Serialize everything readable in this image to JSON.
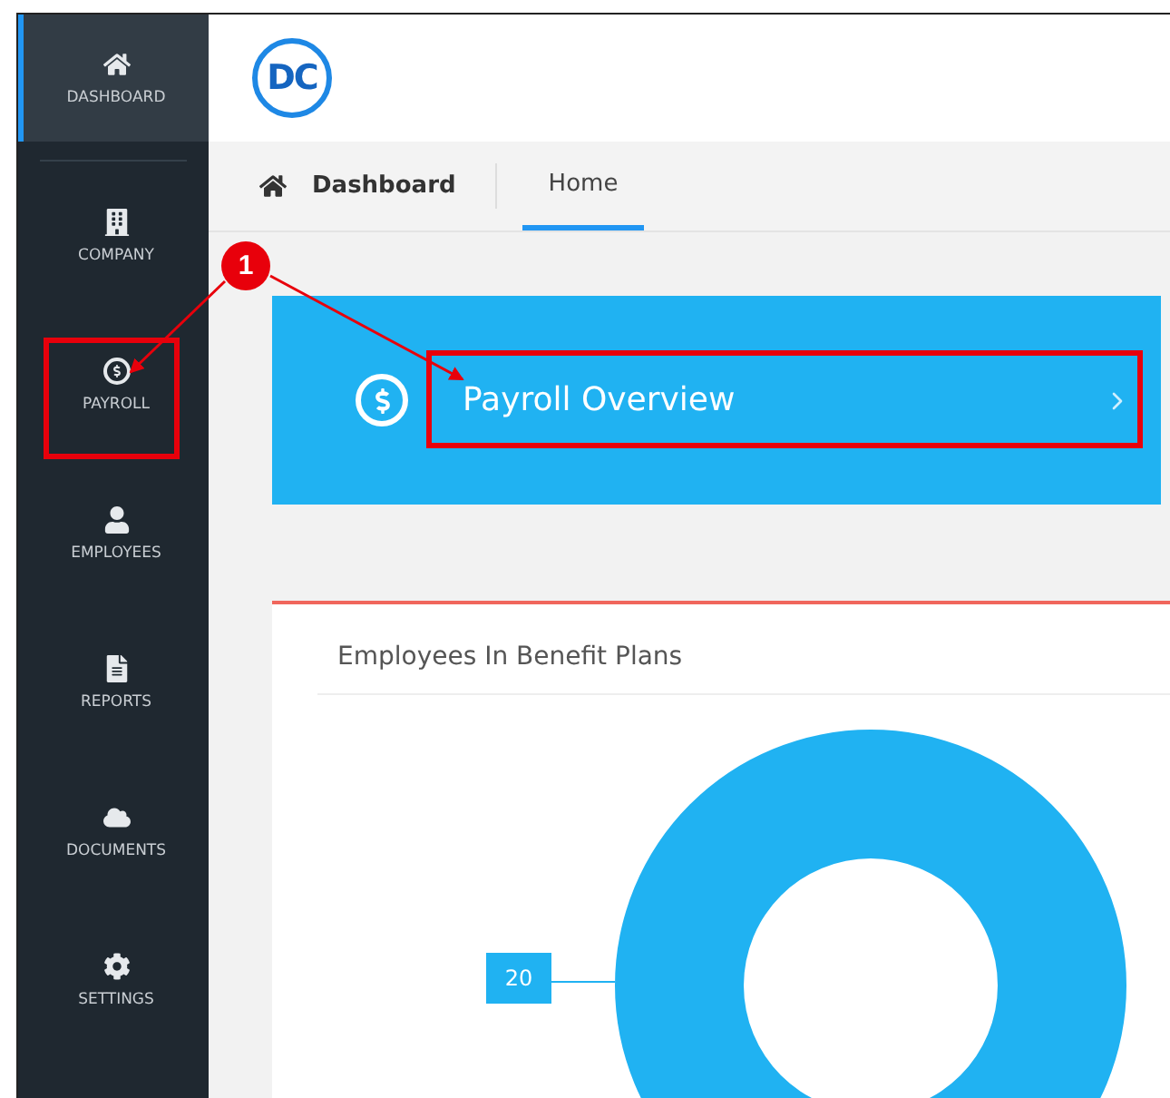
{
  "sidebar": {
    "items": [
      {
        "label": "DASHBOARD",
        "kind": "home",
        "selected": true
      },
      {
        "label": "COMPANY",
        "kind": "building",
        "selected": false
      },
      {
        "label": "PAYROLL",
        "kind": "dollar",
        "selected": false
      },
      {
        "label": "EMPLOYEES",
        "kind": "user",
        "selected": false
      },
      {
        "label": "REPORTS",
        "kind": "report",
        "selected": false
      },
      {
        "label": "DOCUMENTS",
        "kind": "cloud",
        "selected": false
      },
      {
        "label": "SETTINGS",
        "kind": "gear",
        "selected": false
      }
    ]
  },
  "header": {
    "logo": "DC"
  },
  "breadcrumb": {
    "title": "Dashboard",
    "tabs": [
      {
        "label": "Home",
        "selected": true
      }
    ]
  },
  "banner": {
    "label": "Payroll Overview"
  },
  "annotation": {
    "step": "1"
  },
  "card": {
    "title": "Employees In Benefit Plans",
    "callout": "20"
  }
}
